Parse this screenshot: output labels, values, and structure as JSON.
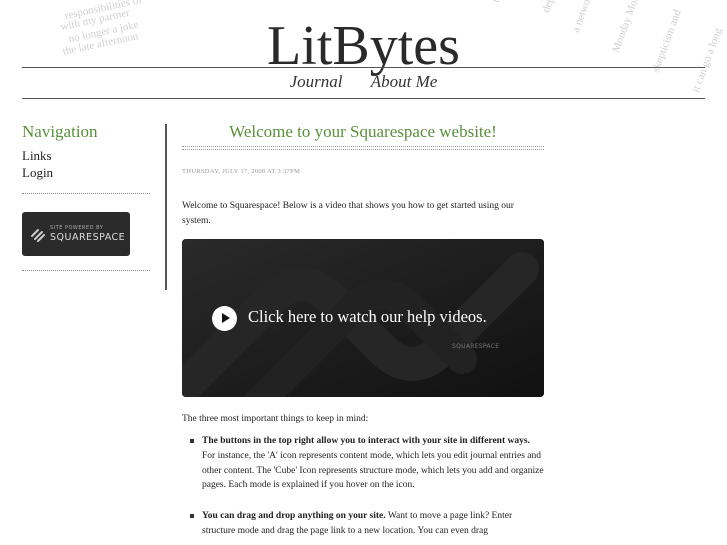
{
  "header": {
    "site_title": "LitBytes",
    "nav": [
      "Journal",
      "About Me"
    ]
  },
  "sidebar": {
    "heading": "Navigation",
    "links": [
      "Links",
      "Login"
    ],
    "badge_small": "SITE POWERED BY",
    "badge_big": "SQUARESPACE"
  },
  "post": {
    "title": "Welcome to your Squarespace website!",
    "date": "THURSDAY, JULY 17, 2008 AT 3:37PM",
    "intro": "Welcome to Squarespace!  Below is a video that shows you how to get started using our system.",
    "video_text": "Click here to watch our help videos.",
    "video_brand": "SQUARESPACE",
    "three_things": "The three most important things to keep in mind:",
    "bullets": [
      {
        "bold": "The buttons in the top right allow you to interact with your site in different ways.",
        "text": "  For instance, the 'A' icon represents content mode, which lets you edit journal entries and other content.  The 'Cube' Icon represents structure mode, which lets you add and organize pages.  Each mode is explained if you hover on the icon."
      },
      {
        "bold": "You can drag and drop anything on your site.",
        "text": "  Want to move a page link? Enter structure mode and drag the page link to a new location.  You can even drag"
      }
    ]
  },
  "colors": {
    "accent": "#5a8f3c",
    "rule": "#555555"
  }
}
